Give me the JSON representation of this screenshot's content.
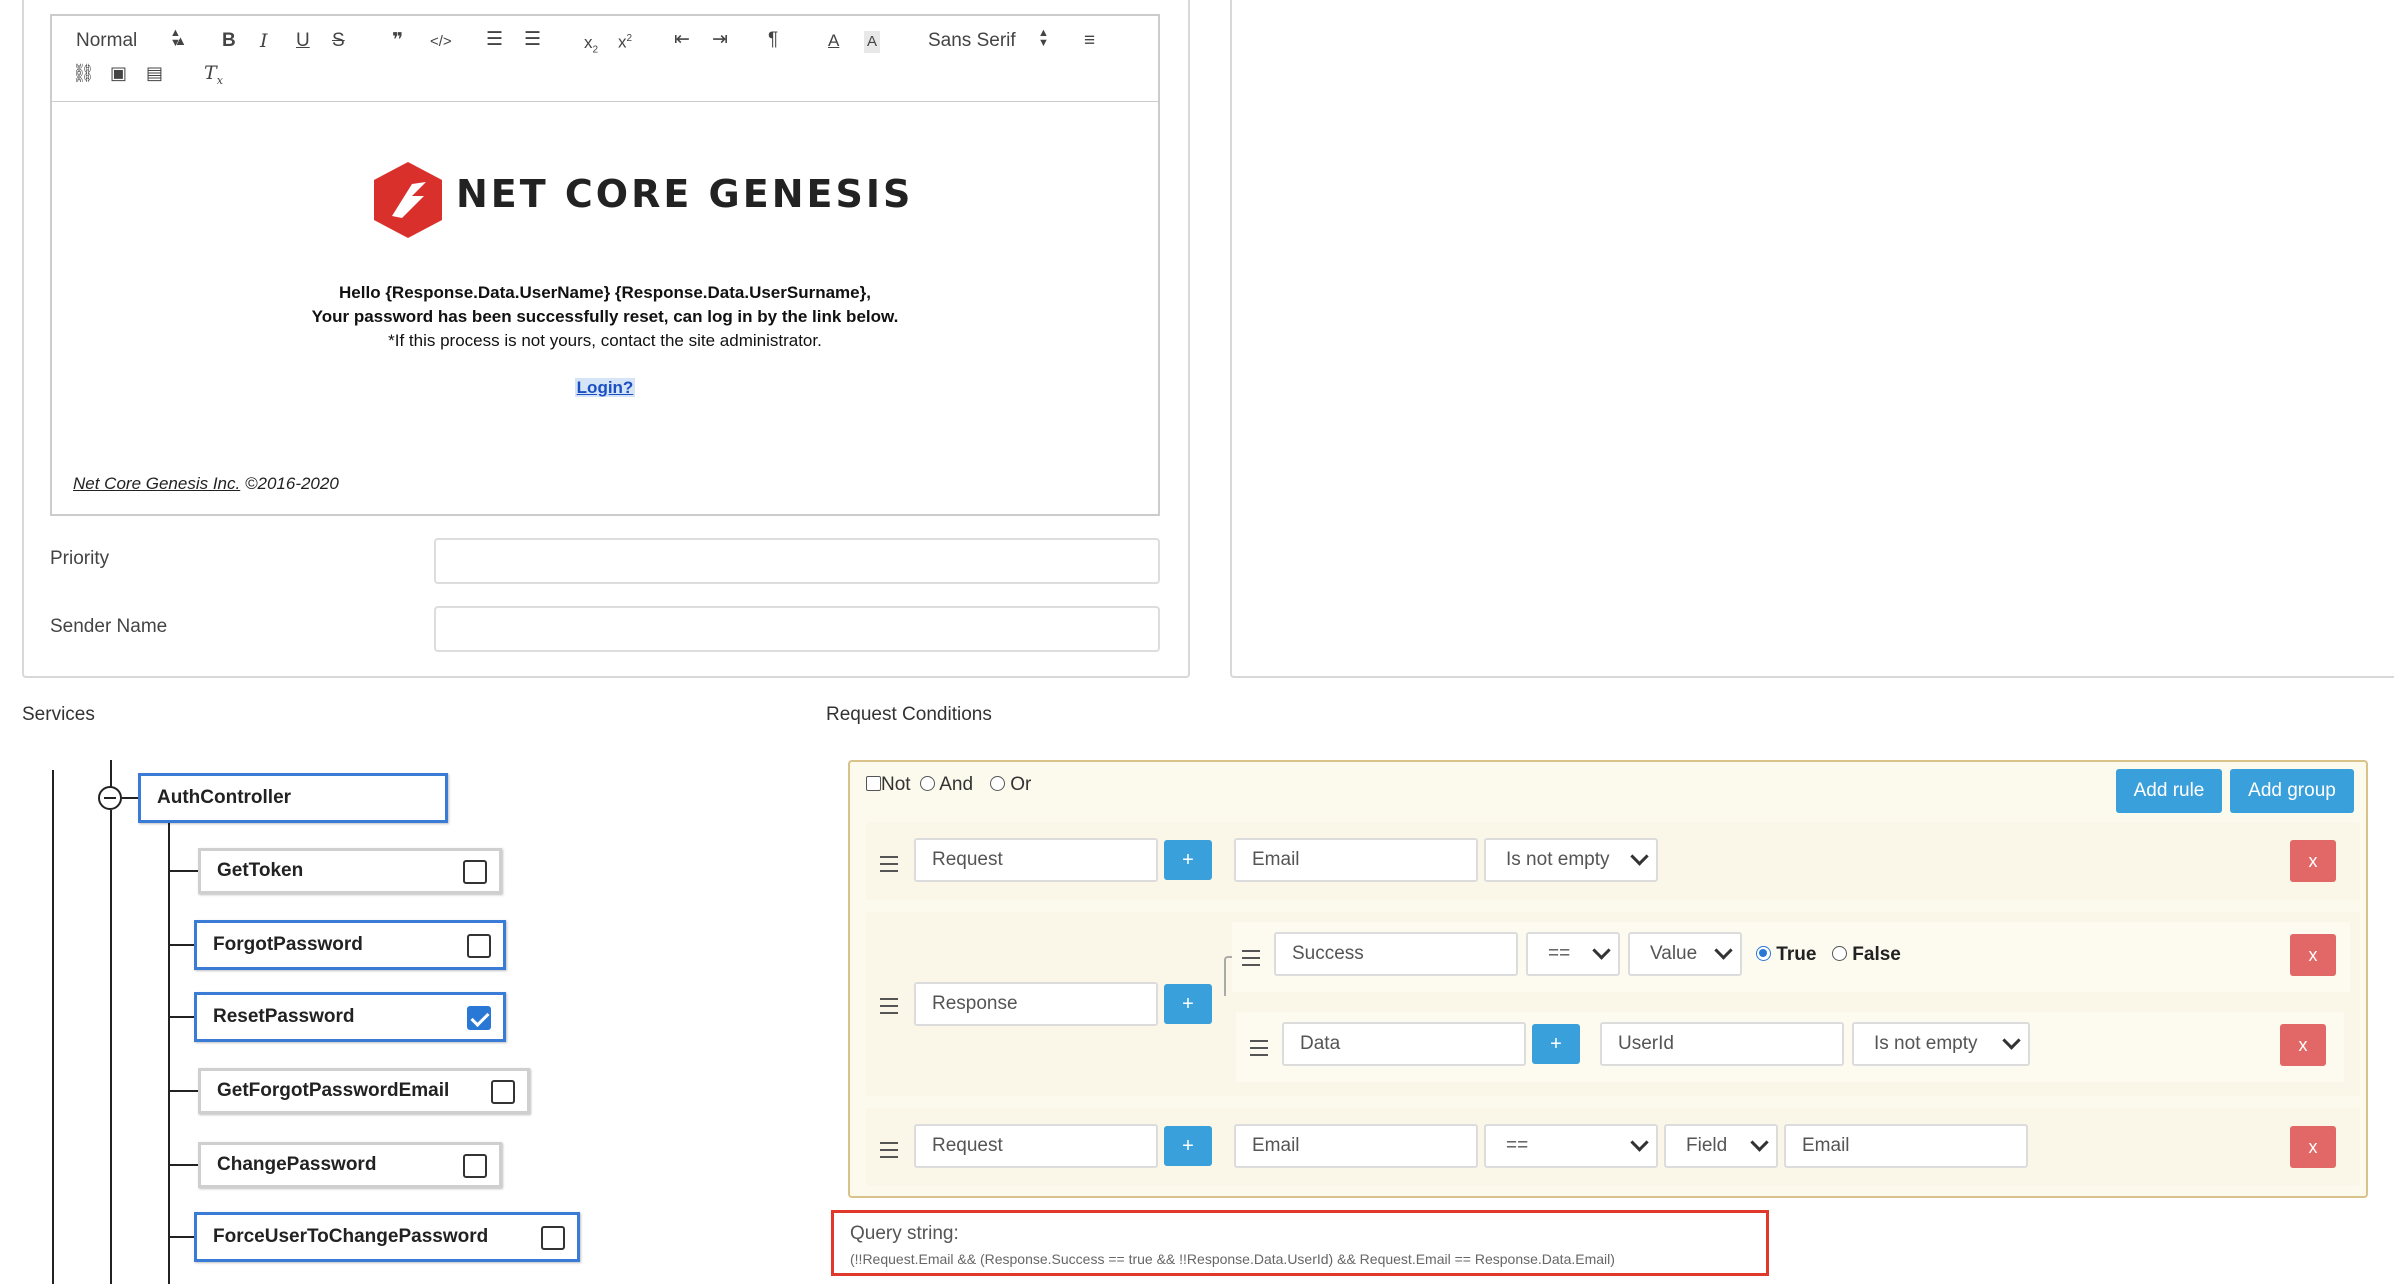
{
  "editor": {
    "toolbar": {
      "heading_select": "Normal",
      "font_select": "Sans Serif",
      "icons": [
        "bold-icon",
        "italic-icon",
        "underline-icon",
        "strike-icon",
        "blockquote-icon",
        "code-icon",
        "ordered-list-icon",
        "bullet-list-icon",
        "subscript-icon",
        "superscript-icon",
        "outdent-icon",
        "indent-icon",
        "rtl-icon",
        "font-color-icon",
        "background-color-icon",
        "align-icon",
        "link-icon",
        "image-icon",
        "video-icon",
        "clear-format-icon"
      ]
    },
    "content": {
      "logo_text": "NET CORE GENESIS",
      "line1": "Hello {Response.Data.UserName} {Response.Data.UserSurname},",
      "line2": "Your password has been successfully reset, can log in by the link below.",
      "line3": "*If this process is not yours, contact the site administrator.",
      "link": "Login?",
      "footer_company": "Net Core Genesis Inc.",
      "footer_years": " ©2016-2020"
    }
  },
  "form": {
    "priority_label": "Priority",
    "priority_value": "",
    "sender_label": "Sender Name",
    "sender_value": ""
  },
  "services": {
    "title": "Services",
    "root": "AuthController",
    "items": [
      {
        "label": "GetToken",
        "checked": false,
        "selected": false
      },
      {
        "label": "ForgotPassword",
        "checked": false,
        "selected": true
      },
      {
        "label": "ResetPassword",
        "checked": true,
        "selected": true
      },
      {
        "label": "GetForgotPasswordEmail",
        "checked": false,
        "selected": false
      },
      {
        "label": "ChangePassword",
        "checked": false,
        "selected": false
      },
      {
        "label": "ForceUserToChangePassword",
        "checked": false,
        "selected": true
      }
    ]
  },
  "conditions": {
    "title": "Request Conditions",
    "not_label": "Not",
    "and_label": "And",
    "or_label": "Or",
    "add_rule": "Add rule",
    "add_group": "Add group",
    "plus": "+",
    "remove": "x",
    "rule1": {
      "entity": "Request",
      "field": "Email",
      "operator": "Is not empty"
    },
    "rule2": {
      "entity": "Response",
      "sub1": {
        "field": "Success",
        "operator": "==",
        "value_type": "Value",
        "true_label": "True",
        "false_label": "False"
      },
      "sub2": {
        "entity": "Data",
        "field": "UserId",
        "operator": "Is not empty"
      }
    },
    "rule3": {
      "entity": "Request",
      "field": "Email",
      "operator": "==",
      "value_type": "Field",
      "value": "Email"
    },
    "query_title": "Query string:",
    "query": "(!!Request.Email && (Response.Success == true && !!Response.Data.UserId) && Request.Email == Response.Data.Email)"
  },
  "colors": {
    "accent": "#3aa0dc",
    "danger": "#e26868",
    "selected_border": "#3a7bd5",
    "logo_red": "#d9302c",
    "query_border": "#e0392b"
  }
}
